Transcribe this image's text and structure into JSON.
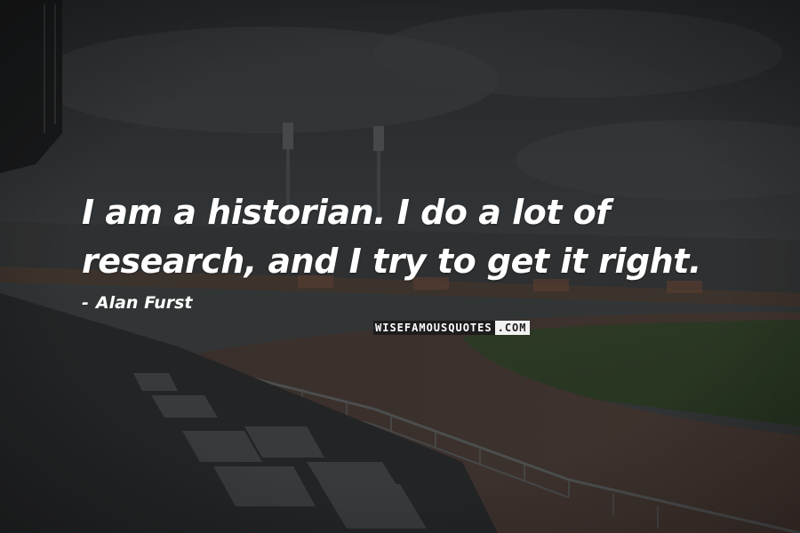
{
  "quote": {
    "line1": "I am a historian. I do a lot of",
    "line2": "research, and I try to get it right."
  },
  "author": {
    "dash": "-",
    "name": "Alan Furst"
  },
  "watermark": {
    "part1": "WISEFAMOUSQUOTES",
    "part2": ".COM"
  },
  "background": {
    "description_icon": "stadium-photo",
    "sky_color": "#3a3d3f",
    "field_color": "#34452c",
    "track_color": "#4a3b36",
    "stand_color": "#2b2e30"
  }
}
